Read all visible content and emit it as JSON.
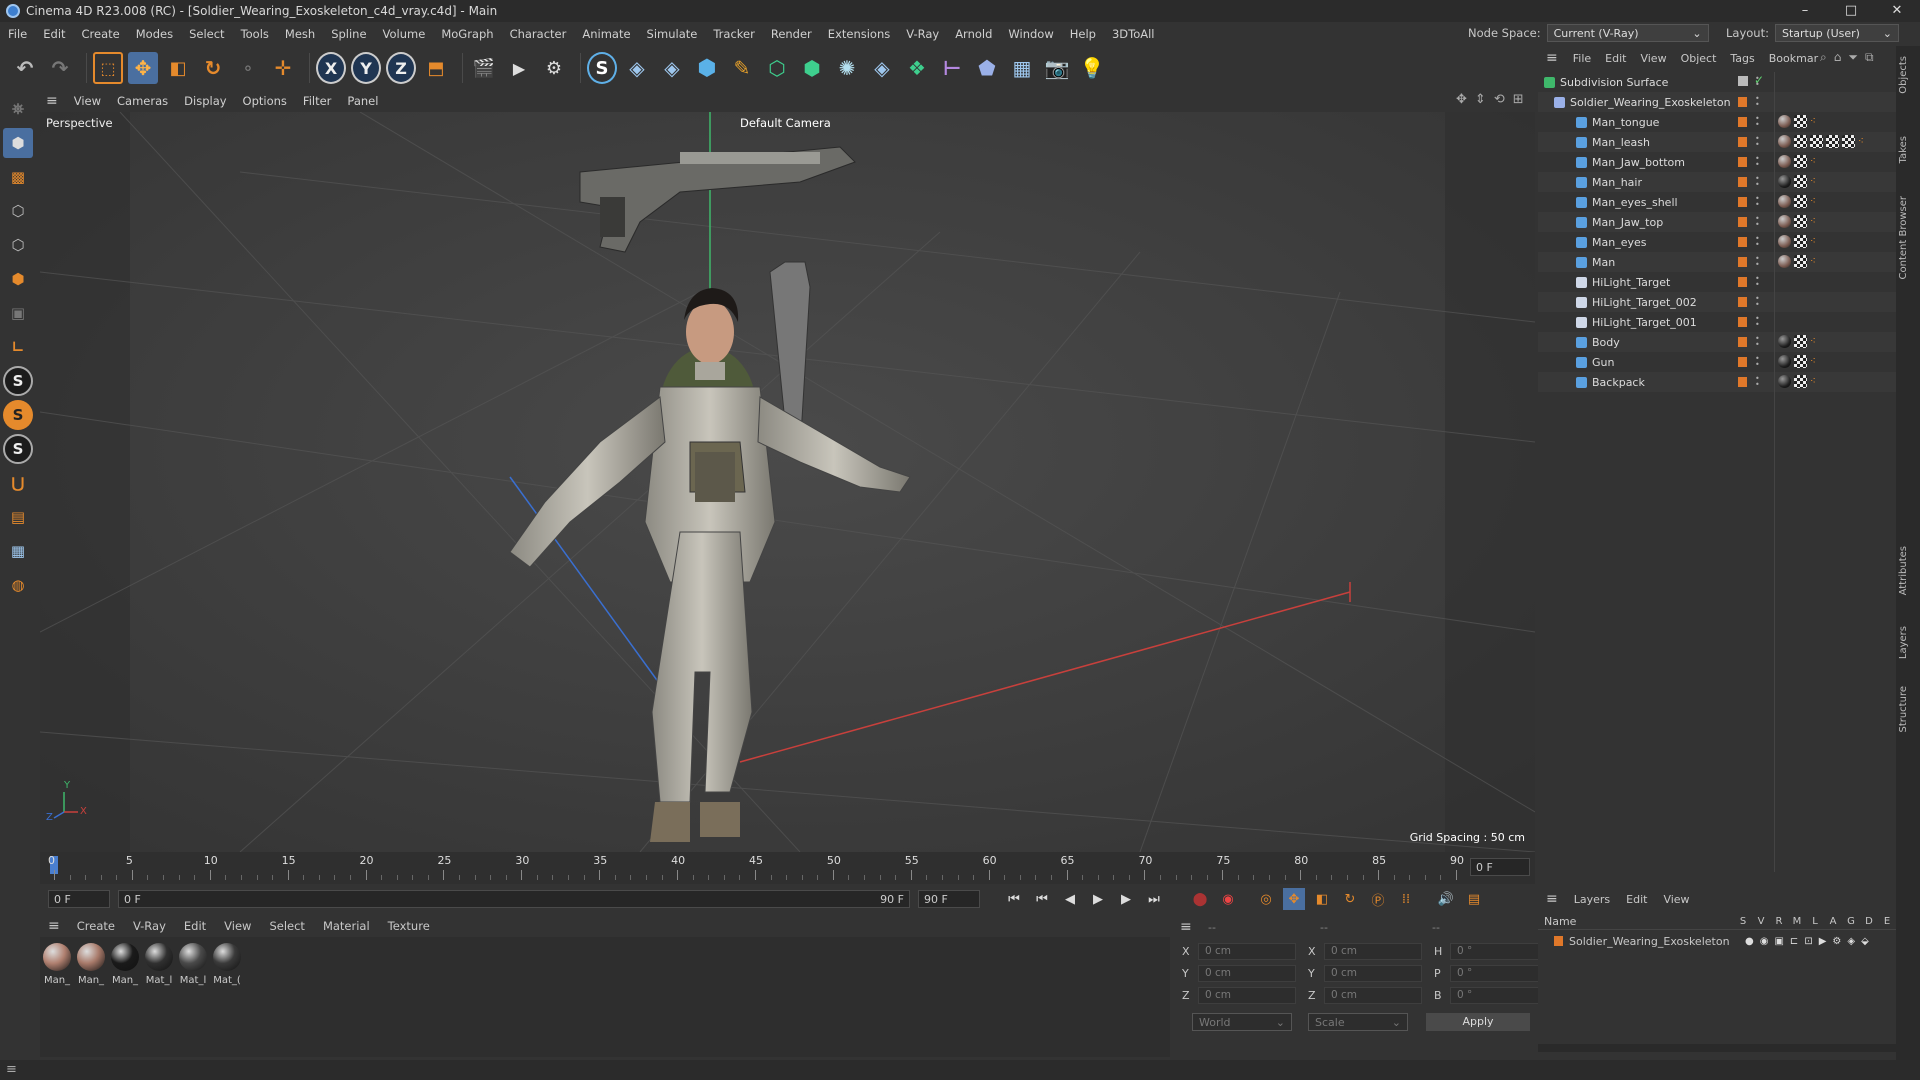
{
  "window": {
    "title": "Cinema 4D R23.008 (RC) - [Soldier_Wearing_Exoskeleton_c4d_vray.c4d] - Main",
    "controls": [
      "–",
      "□",
      "✕"
    ]
  },
  "menubar": {
    "items": [
      "File",
      "Edit",
      "Create",
      "Modes",
      "Select",
      "Tools",
      "Mesh",
      "Spline",
      "Volume",
      "MoGraph",
      "Character",
      "Animate",
      "Simulate",
      "Tracker",
      "Render",
      "Extensions",
      "V-Ray",
      "Arnold",
      "Window",
      "Help",
      "3DToAll"
    ],
    "node_space_label": "Node Space:",
    "node_space_value": "Current (V-Ray)",
    "layout_label": "Layout:",
    "layout_value": "Startup (User)"
  },
  "toolbar": {
    "axis_x": "X",
    "axis_y": "Y",
    "axis_z": "Z"
  },
  "viewport": {
    "menu": [
      "View",
      "Cameras",
      "Display",
      "Options",
      "Filter",
      "Panel"
    ],
    "label": "Perspective",
    "camera": "Default Camera",
    "grid_spacing": "Grid Spacing : 50 cm",
    "axis_x": "X",
    "axis_y": "Y",
    "axis_z": "Z"
  },
  "timeline": {
    "ticks": [
      "0",
      "5",
      "10",
      "15",
      "20",
      "25",
      "30",
      "35",
      "40",
      "45",
      "50",
      "55",
      "60",
      "65",
      "70",
      "75",
      "80",
      "85",
      "90"
    ],
    "current_frame_right": "0 F"
  },
  "transport": {
    "start": "0 F",
    "range_left": "0 F",
    "range_right": "90 F",
    "end": "90 F"
  },
  "materials": {
    "menu": [
      "Create",
      "V-Ray",
      "Edit",
      "View",
      "Select",
      "Material",
      "Texture"
    ],
    "items": [
      {
        "name": "Man_",
        "color": "#b08070"
      },
      {
        "name": "Man_",
        "color": "#a87a6a"
      },
      {
        "name": "Man_",
        "color": "#1a1a1a"
      },
      {
        "name": "Mat_l",
        "color": "#303030"
      },
      {
        "name": "Mat_l",
        "color": "#4a4a4a"
      },
      {
        "name": "Mat_(",
        "color": "#3a3a3a"
      }
    ]
  },
  "coords": {
    "header_left": "--",
    "header_mid": "--",
    "header_right": "--",
    "rows": [
      {
        "a": "X",
        "av": "0 cm",
        "b": "X",
        "bv": "0 cm",
        "c": "H",
        "cv": "0 °"
      },
      {
        "a": "Y",
        "av": "0 cm",
        "b": "Y",
        "bv": "0 cm",
        "c": "P",
        "cv": "0 °"
      },
      {
        "a": "Z",
        "av": "0 cm",
        "b": "Z",
        "bv": "0 cm",
        "c": "B",
        "cv": "0 °"
      }
    ],
    "world": "World",
    "scale": "Scale",
    "apply": "Apply"
  },
  "objects": {
    "menu": [
      "File",
      "Edit",
      "View",
      "Object",
      "Tags",
      "Bookmar"
    ],
    "root": "Subdivision Surface",
    "group": "Soldier_Wearing_Exoskeleton",
    "items": [
      {
        "name": "Man_tongue",
        "tags": [
          "ball",
          "chk",
          "dot"
        ]
      },
      {
        "name": "Man_leash",
        "tags": [
          "ball",
          "chk",
          "chk",
          "chk",
          "chk",
          "dot"
        ]
      },
      {
        "name": "Man_Jaw_bottom",
        "tags": [
          "ball",
          "chk",
          "dot"
        ]
      },
      {
        "name": "Man_hair",
        "tags": [
          "dark",
          "chk",
          "dot"
        ]
      },
      {
        "name": "Man_eyes_shell",
        "tags": [
          "ball",
          "chk",
          "dot"
        ]
      },
      {
        "name": "Man_Jaw_top",
        "tags": [
          "ball",
          "chk",
          "dot"
        ]
      },
      {
        "name": "Man_eyes",
        "tags": [
          "ball",
          "chk",
          "dot"
        ]
      },
      {
        "name": "Man",
        "tags": [
          "ball",
          "chk",
          "dot"
        ]
      },
      {
        "name": "HiLight_Target",
        "tags": []
      },
      {
        "name": "HiLight_Target_002",
        "tags": []
      },
      {
        "name": "HiLight_Target_001",
        "tags": []
      },
      {
        "name": "Body",
        "tags": [
          "dark",
          "chk",
          "dot"
        ]
      },
      {
        "name": "Gun",
        "tags": [
          "dark",
          "chk",
          "dot"
        ]
      },
      {
        "name": "Backpack",
        "tags": [
          "dark",
          "chk",
          "dot"
        ]
      }
    ]
  },
  "layers": {
    "menu": [
      "Layers",
      "Edit",
      "View"
    ],
    "header_name": "Name",
    "cols": [
      "S",
      "V",
      "R",
      "M",
      "L",
      "A",
      "G",
      "D",
      "E"
    ],
    "row": "Soldier_Wearing_Exoskeleton"
  },
  "right_tabs": [
    "Objects",
    "Takes",
    "Content Browser",
    "Attributes",
    "Layers",
    "Structure"
  ]
}
